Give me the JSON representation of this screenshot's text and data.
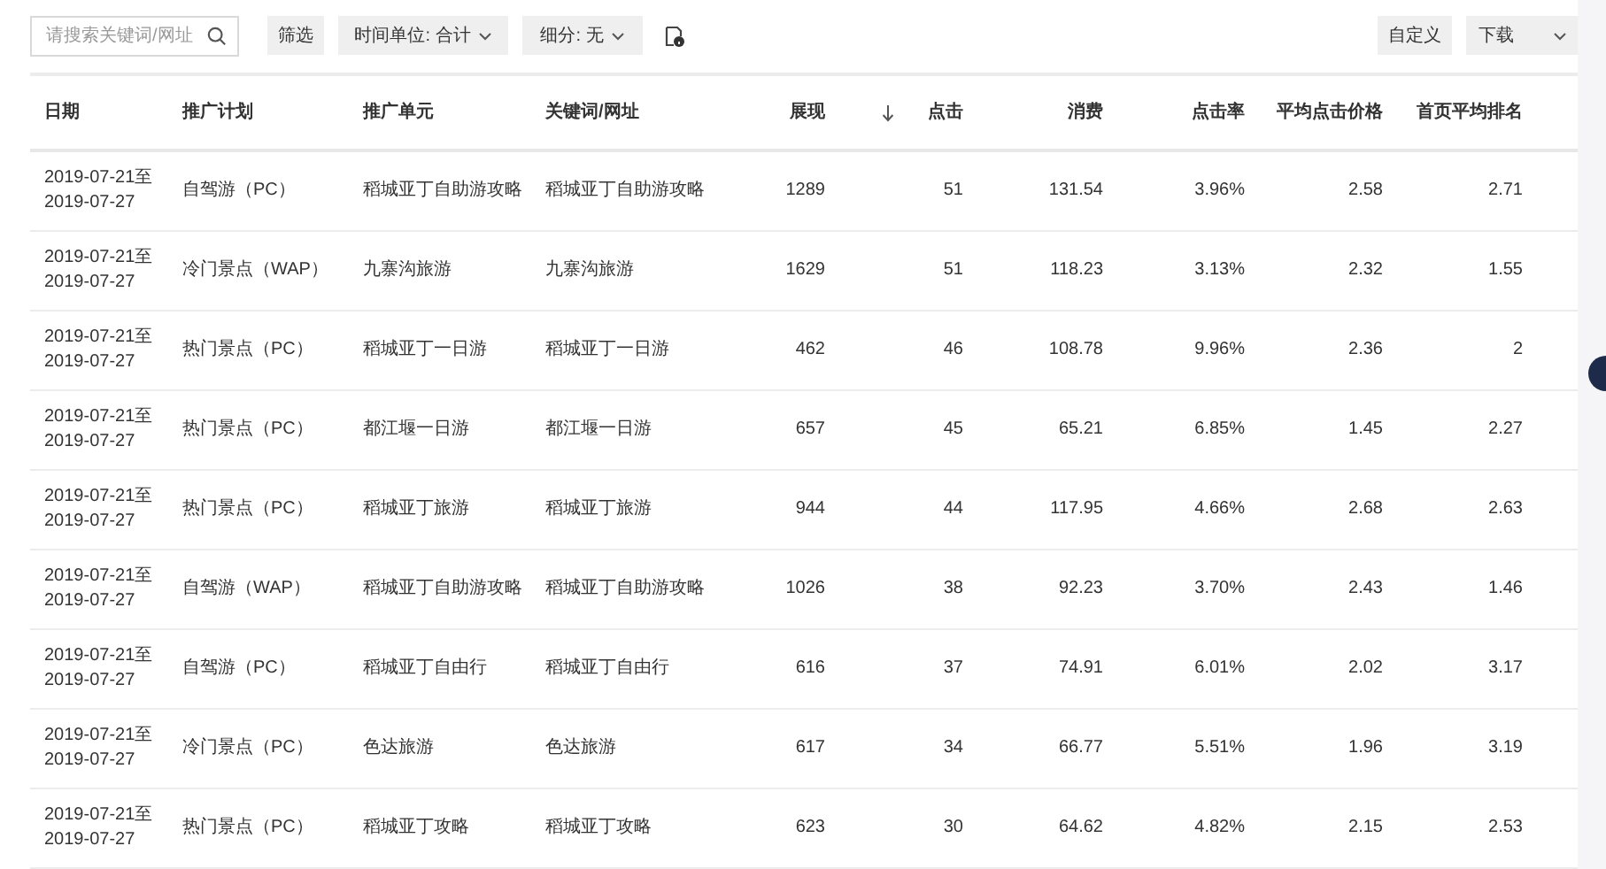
{
  "toolbar": {
    "search": {
      "placeholder": "请搜索关键词/网址"
    },
    "filter_button": "筛选",
    "time_unit": "时间单位: 合计",
    "segment": "细分: 无",
    "customize_button": "自定义",
    "download": "下载"
  },
  "table": {
    "columns": [
      {
        "label": "日期",
        "sorted": false
      },
      {
        "label": "推广计划",
        "sorted": false
      },
      {
        "label": "推广单元",
        "sorted": false
      },
      {
        "label": "关键词/网址",
        "sorted": false
      },
      {
        "label": "展现",
        "sorted": false
      },
      {
        "label": "点击",
        "sorted": true
      },
      {
        "label": "消费",
        "sorted": false
      },
      {
        "label": "点击率",
        "sorted": false
      },
      {
        "label": "平均点击价格",
        "sorted": false
      },
      {
        "label": "首页平均排名",
        "sorted": false
      }
    ],
    "rows": [
      {
        "cells": [
          "2019-07-21至\n2019-07-27",
          "自驾游（PC）",
          "稻城亚丁自助游攻略",
          "稻城亚丁自助游攻略",
          "1289",
          "51",
          "131.54",
          "3.96%",
          "2.58",
          "2.71"
        ]
      },
      {
        "cells": [
          "2019-07-21至\n2019-07-27",
          "冷门景点（WAP）",
          "九寨沟旅游",
          "九寨沟旅游",
          "1629",
          "51",
          "118.23",
          "3.13%",
          "2.32",
          "1.55"
        ]
      },
      {
        "cells": [
          "2019-07-21至\n2019-07-27",
          "热门景点（PC）",
          "稻城亚丁一日游",
          "稻城亚丁一日游",
          "462",
          "46",
          "108.78",
          "9.96%",
          "2.36",
          "2"
        ]
      },
      {
        "cells": [
          "2019-07-21至\n2019-07-27",
          "热门景点（PC）",
          "都江堰一日游",
          "都江堰一日游",
          "657",
          "45",
          "65.21",
          "6.85%",
          "1.45",
          "2.27"
        ]
      },
      {
        "cells": [
          "2019-07-21至\n2019-07-27",
          "热门景点（PC）",
          "稻城亚丁旅游",
          "稻城亚丁旅游",
          "944",
          "44",
          "117.95",
          "4.66%",
          "2.68",
          "2.63"
        ]
      },
      {
        "cells": [
          "2019-07-21至\n2019-07-27",
          "自驾游（WAP）",
          "稻城亚丁自助游攻略",
          "稻城亚丁自助游攻略",
          "1026",
          "38",
          "92.23",
          "3.70%",
          "2.43",
          "1.46"
        ]
      },
      {
        "cells": [
          "2019-07-21至\n2019-07-27",
          "自驾游（PC）",
          "稻城亚丁自由行",
          "稻城亚丁自由行",
          "616",
          "37",
          "74.91",
          "6.01%",
          "2.02",
          "3.17"
        ]
      },
      {
        "cells": [
          "2019-07-21至\n2019-07-27",
          "冷门景点（PC）",
          "色达旅游",
          "色达旅游",
          "617",
          "34",
          "66.77",
          "5.51%",
          "1.96",
          "3.19"
        ]
      },
      {
        "cells": [
          "2019-07-21至\n2019-07-27",
          "热门景点（PC）",
          "稻城亚丁攻略",
          "稻城亚丁攻略",
          "623",
          "30",
          "64.62",
          "4.82%",
          "2.15",
          "2.53"
        ]
      }
    ]
  }
}
